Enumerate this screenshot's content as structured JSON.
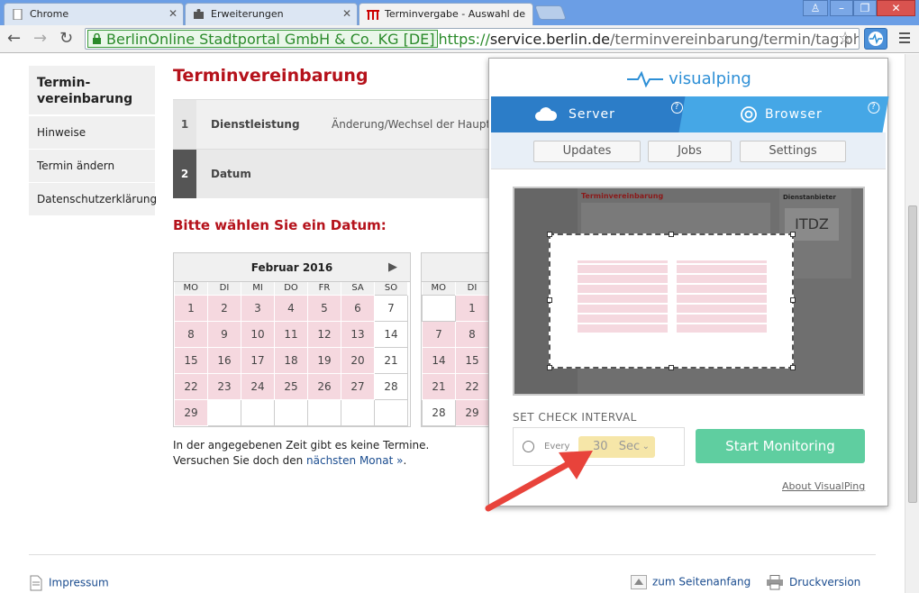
{
  "browser": {
    "tabs": [
      {
        "title": "Chrome"
      },
      {
        "title": "Erweiterungen"
      },
      {
        "title": "Terminvergabe - Auswahl de"
      }
    ],
    "ev_badge": "BerlinOnline Stadtportal GmbH & Co. KG [DE]",
    "url_scheme": "https://",
    "url_host": "service.berlin.de",
    "url_path": "/terminvereinbarung/termin/tag.php?termin",
    "back_icon": "arrow-left-icon",
    "forward_icon": "arrow-right-icon",
    "reload_icon": "reload-icon"
  },
  "page": {
    "sidenav": [
      {
        "label": "Termin-\nvereinbarung",
        "active": true
      },
      {
        "label": "Hinweise"
      },
      {
        "label": "Termin ändern"
      },
      {
        "label": "Datenschutzerklärung"
      }
    ],
    "title": "Terminvereinbarung",
    "steps": [
      {
        "num": "1",
        "label": "Dienstleistung",
        "value": "Änderung/Wechsel der Hauptw"
      },
      {
        "num": "2",
        "label": "Datum",
        "value": ""
      }
    ],
    "subtitle": "Bitte wählen Sie ein Datum:",
    "calendar": {
      "month": "Februar 2016",
      "weekdays": [
        "MO",
        "DI",
        "MI",
        "DO",
        "FR",
        "SA",
        "SO"
      ],
      "rows": [
        [
          "1",
          "2",
          "3",
          "4",
          "5",
          "6",
          "7"
        ],
        [
          "8",
          "9",
          "10",
          "11",
          "12",
          "13",
          "14"
        ],
        [
          "15",
          "16",
          "17",
          "18",
          "19",
          "20",
          "21"
        ],
        [
          "22",
          "23",
          "24",
          "25",
          "26",
          "27",
          "28"
        ],
        [
          "29",
          "",
          "",
          "",
          "",
          "",
          ""
        ]
      ]
    },
    "calendar2": {
      "weekdays": [
        "MO",
        "DI"
      ],
      "rows": [
        [
          "",
          "1"
        ],
        [
          "7",
          "8"
        ],
        [
          "14",
          "15"
        ],
        [
          "21",
          "22"
        ],
        [
          "28",
          "29"
        ]
      ]
    },
    "note_line1": "In der angegebenen Zeit gibt es keine Termine.",
    "note_line2_prefix": "Versuchen Sie doch den ",
    "note_link": "nächsten Monat »",
    "note_line2_suffix": ".",
    "footer": {
      "impressum": "Impressum",
      "top": "zum Seitenanfang",
      "print": "Druckversion"
    }
  },
  "visualping": {
    "logo": "visualping",
    "tabs": {
      "server": "Server",
      "browser": "Browser",
      "help": "?"
    },
    "buttons": {
      "updates": "Updates",
      "jobs": "Jobs",
      "settings": "Settings"
    },
    "interval_label": "SET CHECK INTERVAL",
    "every_label": "Every",
    "interval_value": "30",
    "interval_unit": "Sec",
    "start_label": "Start Monitoring",
    "about_label": "About VisualPing",
    "preview": {
      "title": "Terminvereinbarung",
      "side_title": "Dienstanbieter",
      "logo_text": "ITDZ"
    }
  },
  "colors": {
    "accent_red": "#b5121b",
    "booked_pink": "#f5d8df",
    "vp_blue": "#2c7dc8",
    "vp_green": "#5fcea0",
    "select_yellow": "#f6e6a8"
  }
}
